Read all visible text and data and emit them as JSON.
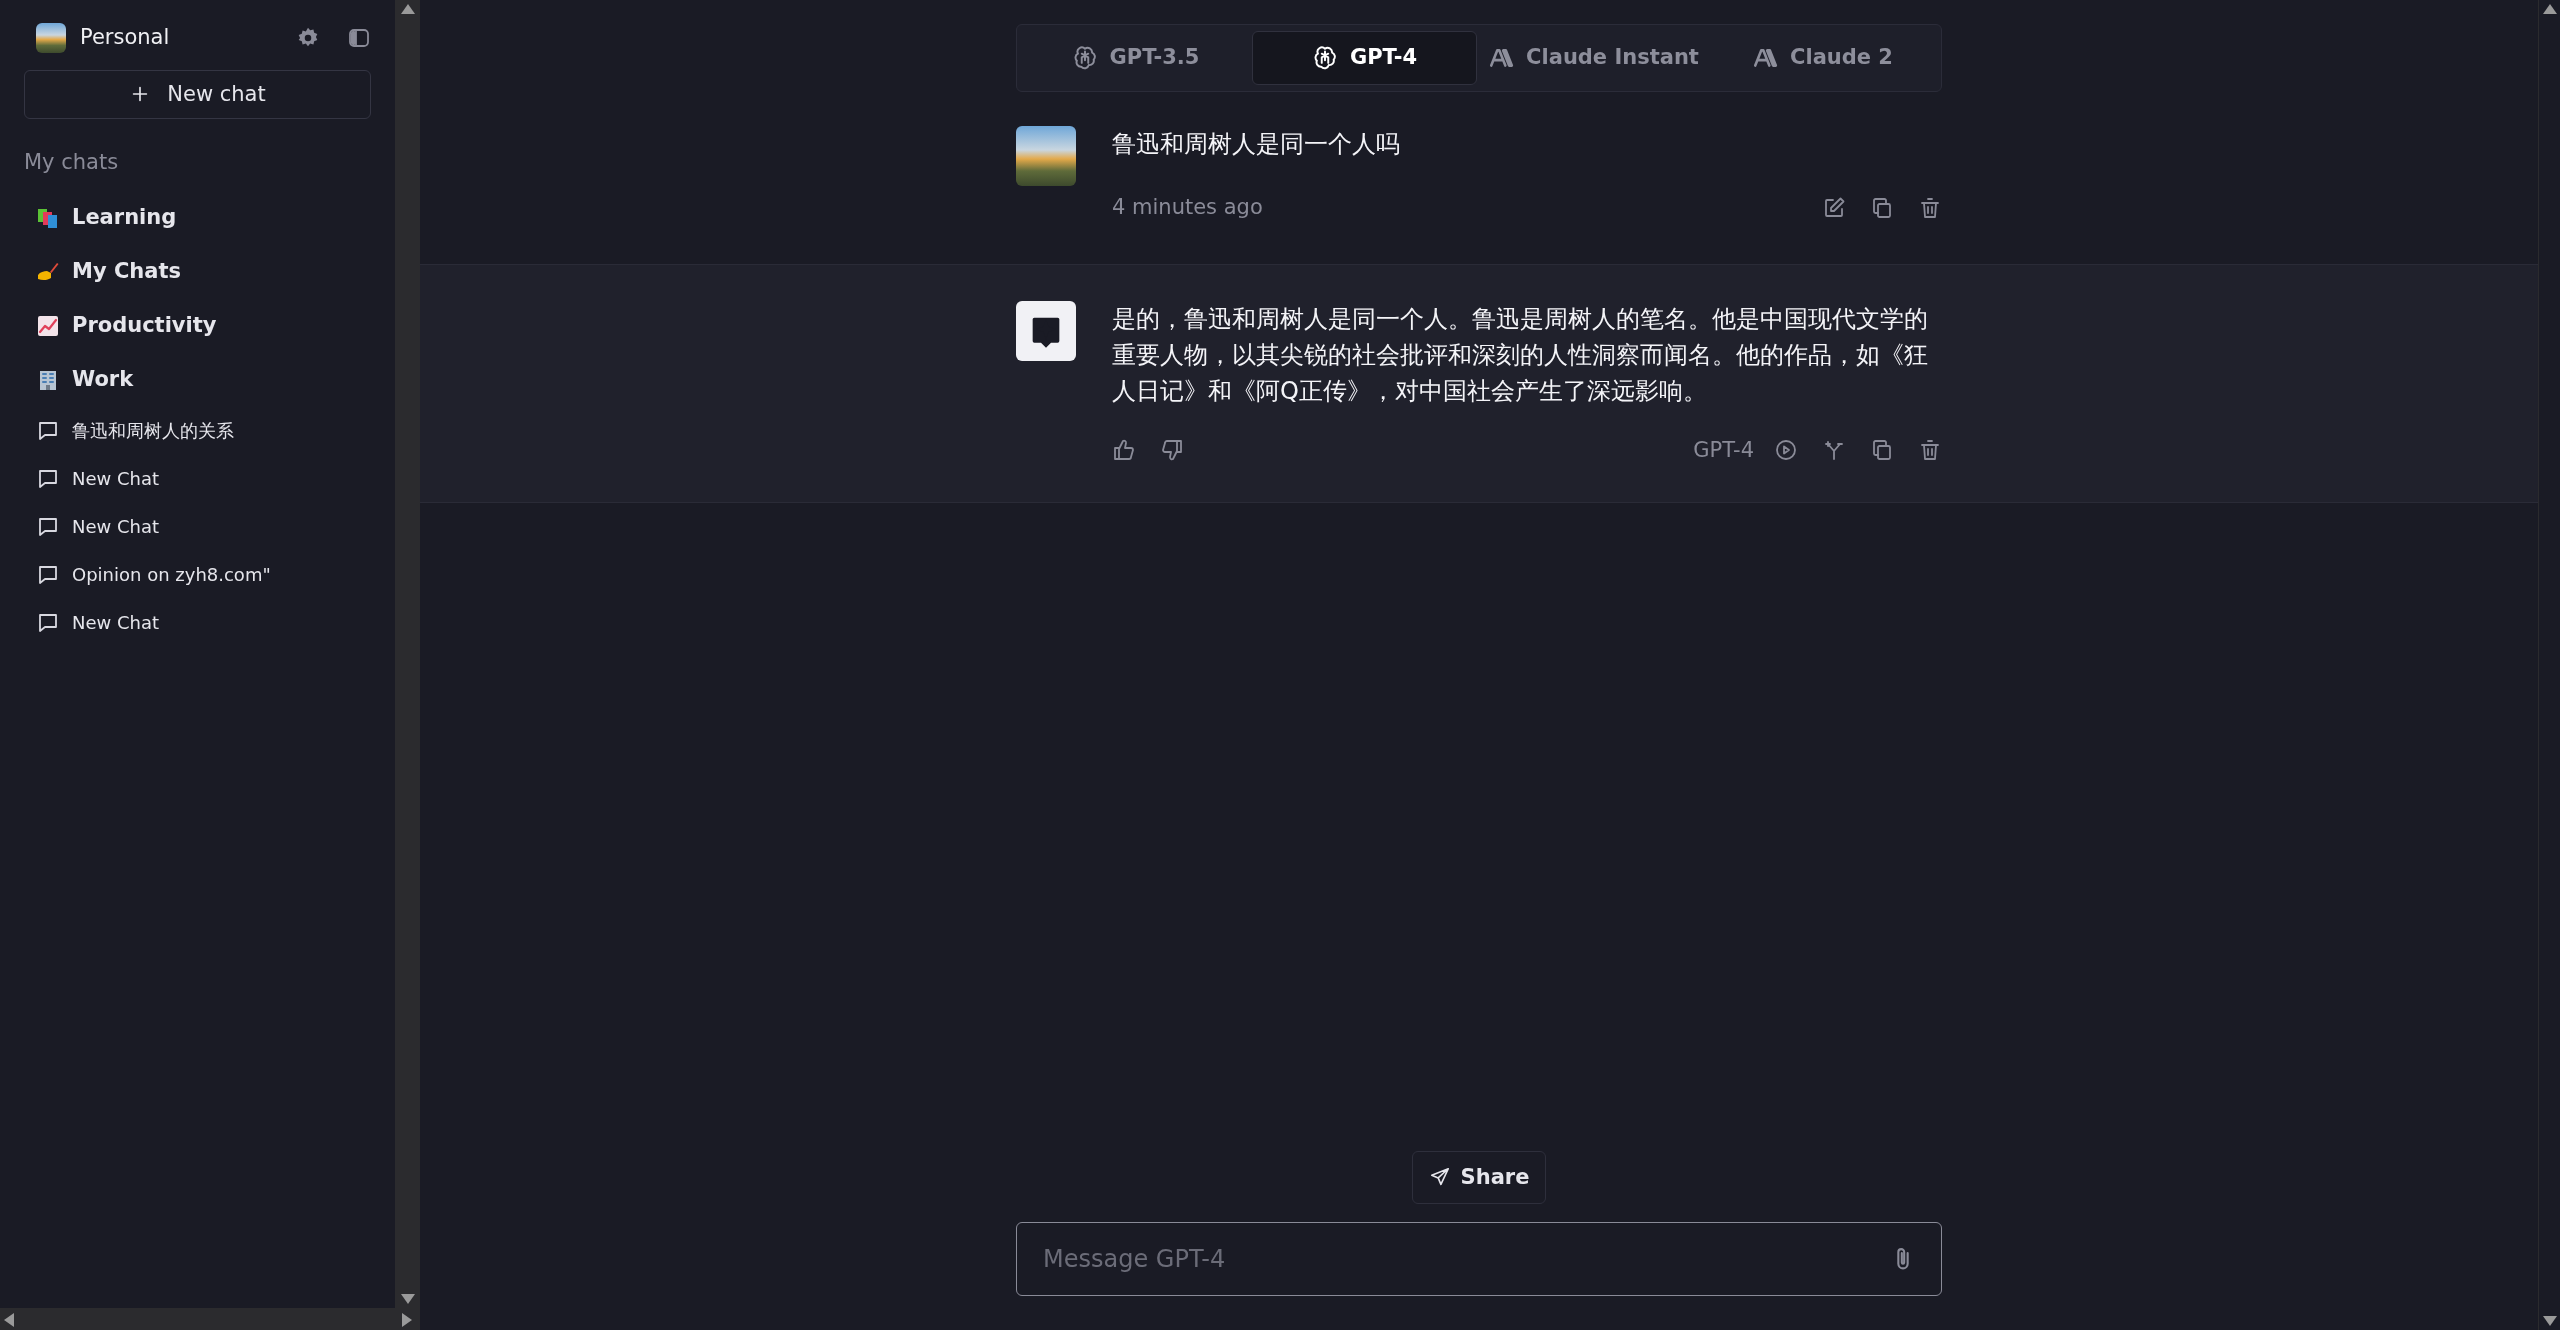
{
  "sidebar": {
    "profile_name": "Personal",
    "new_chat_button": "New chat",
    "section_title": "My chats",
    "items": [
      {
        "kind": "folder",
        "label": "Learning"
      },
      {
        "kind": "folder",
        "label": "My Chats"
      },
      {
        "kind": "folder",
        "label": "Productivity"
      },
      {
        "kind": "folder",
        "label": "Work"
      },
      {
        "kind": "chat",
        "label": "鲁迅和周树人的关系"
      },
      {
        "kind": "chat",
        "label": "New Chat"
      },
      {
        "kind": "chat",
        "label": "New Chat"
      },
      {
        "kind": "chat",
        "label": "Opinion on zyh8.com\""
      },
      {
        "kind": "chat",
        "label": "New Chat"
      }
    ]
  },
  "model_tabs": [
    {
      "label": "GPT-3.5",
      "kind": "knot",
      "selected": false
    },
    {
      "label": "GPT-4",
      "kind": "knot",
      "selected": true
    },
    {
      "label": "Claude Instant",
      "kind": "letters",
      "selected": false
    },
    {
      "label": "Claude 2",
      "kind": "letters",
      "selected": false
    }
  ],
  "messages": [
    {
      "kind": "user",
      "text": "鲁迅和周树人是同一个人吗",
      "time": "4 minutes ago"
    },
    {
      "kind": "assistant",
      "text": "是的，鲁迅和周树人是同一个人。鲁迅是周树人的笔名。他是中国现代文学的重要人物，以其尖锐的社会批评和深刻的人性洞察而闻名。他的作品，如《狂人日记》和《阿Q正传》，对中国社会产生了深远影响。",
      "model": "GPT-4"
    }
  ],
  "share_button": "Share",
  "composer": {
    "placeholder": "Message GPT-4"
  }
}
